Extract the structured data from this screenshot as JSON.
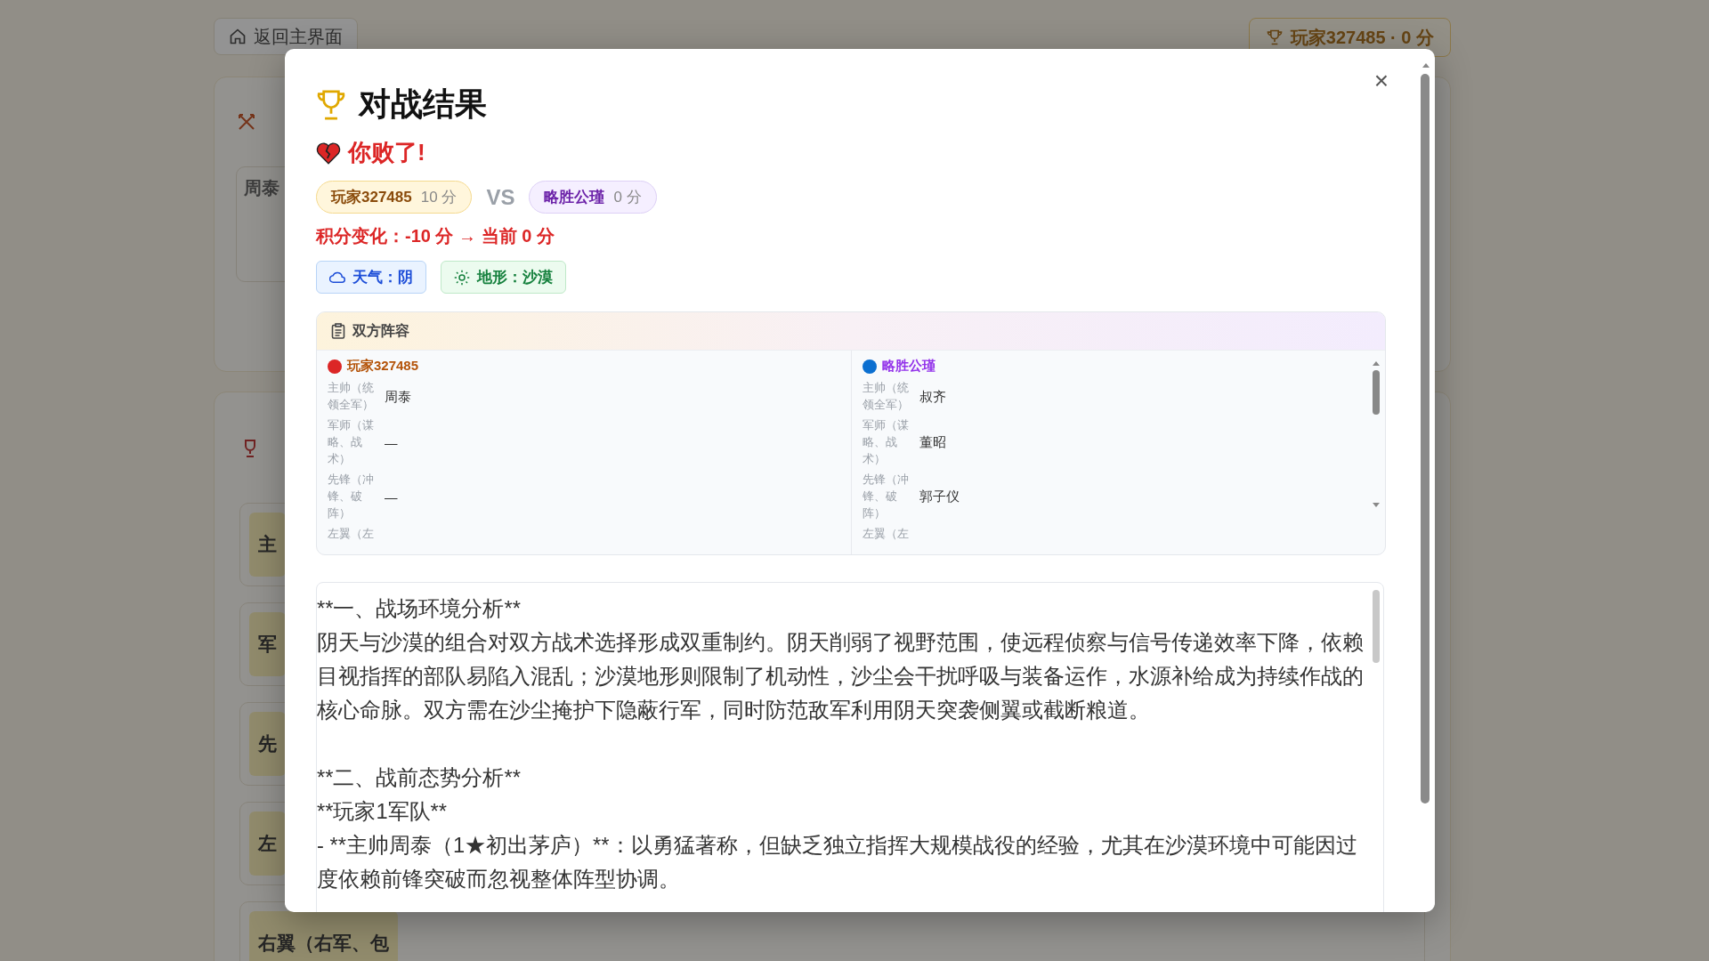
{
  "background": {
    "back_button": "返回主界面",
    "player_badge": "玩家327485 · 0 分",
    "card_general": "周泰",
    "slots": [
      "主",
      "军",
      "先",
      "左",
      "右翼（右军、包"
    ]
  },
  "dialog": {
    "title": "对战结果",
    "close": "×",
    "result": "你败了!",
    "players": [
      {
        "name": "玩家327485",
        "score": "10 分"
      },
      {
        "name": "略胜公瑾",
        "score": "0 分"
      }
    ],
    "vs": "VS",
    "score_change": "积分变化：-10 分 → 当前 0 分",
    "conditions": [
      {
        "kind": "weather",
        "label": "天气：阴"
      },
      {
        "kind": "terrain",
        "label": "地形：沙漠"
      }
    ],
    "lineup": {
      "title": "双方阵容",
      "sides": [
        {
          "name": "玩家327485",
          "color": "#dc2626",
          "rows": [
            {
              "role": "主帅（统领全军）",
              "general": "周泰"
            },
            {
              "role": "军师（谋略、战术）",
              "general": "—"
            },
            {
              "role": "先锋（冲锋、破阵）",
              "general": "—"
            },
            {
              "role": "左翼（左"
            }
          ]
        },
        {
          "name": "略胜公瑾",
          "color": "#0b6fd0",
          "rows": [
            {
              "role": "主帅（统领全军）",
              "general": "叔齐"
            },
            {
              "role": "军师（谋略、战术）",
              "general": "董昭"
            },
            {
              "role": "先锋（冲锋、破阵）",
              "general": "郭子仪"
            },
            {
              "role": "左翼（左"
            }
          ]
        }
      ]
    },
    "report": [
      [
        "**一、战场环境分析**",
        "阴天与沙漠的组合对双方战术选择形成双重制约。阴天削弱了视野范围，使远程侦察与信号传递效率下降，依赖目视指挥的部队易陷入混乱；沙漠地形则限制了机动性，沙尘会干扰呼吸与装备运作，水源补给成为持续作战的核心命脉。双方需在沙尘掩护下隐蔽行军，同时防范敌军利用阴天突袭侧翼或截断粮道。"
      ],
      [
        "**二、战前态势分析**",
        "**玩家1军队**",
        "- **主帅周泰（1★初出茅庐）**：以勇猛著称，但缺乏独立指挥大规模战役的经验，尤其在沙漠环境中可能因过度依赖前锋突破而忽视整体阵型协调。"
      ]
    ]
  }
}
